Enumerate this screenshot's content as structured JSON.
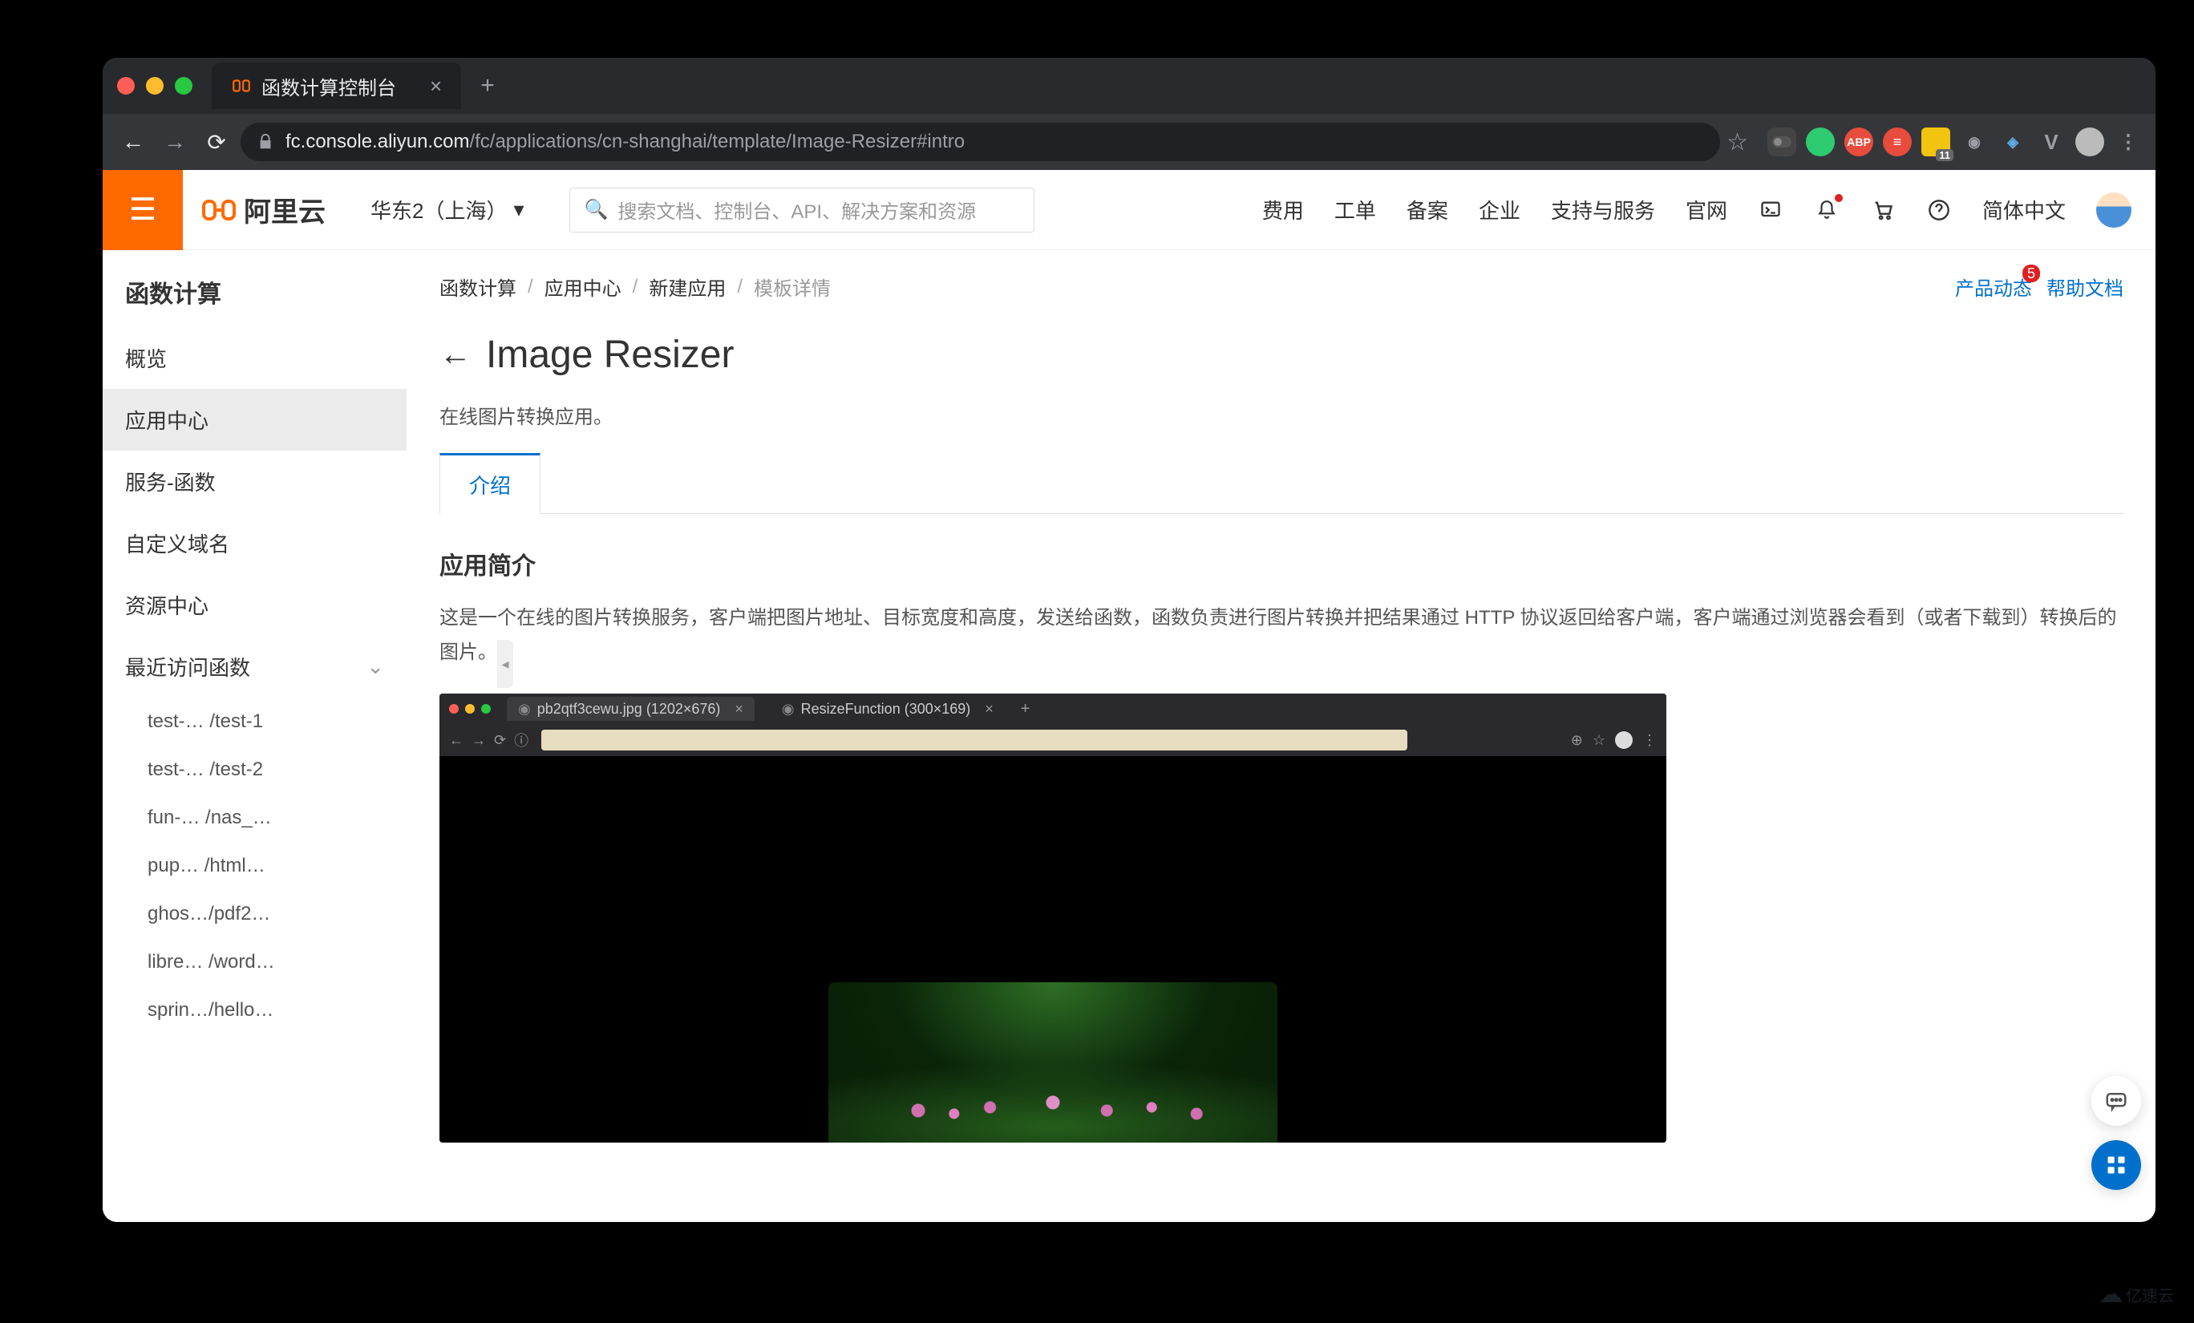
{
  "browser": {
    "tab_title": "函数计算控制台",
    "url_prefix": "fc.console.aliyun.com",
    "url_path": "/fc/applications/cn-shanghai/template/Image-Resizer#intro",
    "ext_badges": {
      "abp": "ABP",
      "num": "11"
    }
  },
  "header": {
    "logo_text": "阿里云",
    "region": "华东2（上海）",
    "search_placeholder": "搜索文档、控制台、API、解决方案和资源",
    "nav": [
      "费用",
      "工单",
      "备案",
      "企业",
      "支持与服务",
      "官网"
    ],
    "lang": "简体中文"
  },
  "sidebar": {
    "title": "函数计算",
    "items": [
      "概览",
      "应用中心",
      "服务-函数",
      "自定义域名",
      "资源中心"
    ],
    "recent_label": "最近访问函数",
    "recent": [
      "test-… /test-1",
      "test-… /test-2",
      "fun-… /nas_…",
      "pup… /html…",
      "ghos…/pdf2…",
      "libre… /word…",
      "sprin…/hello…"
    ]
  },
  "breadcrumb": {
    "items": [
      "函数计算",
      "应用中心",
      "新建应用"
    ],
    "current": "模板详情",
    "notice": "产品动态",
    "notice_badge": "5",
    "help": "帮助文档"
  },
  "page": {
    "title": "Image Resizer",
    "desc": "在线图片转换应用。",
    "tab": "介绍",
    "section_title": "应用简介",
    "section_desc": "这是一个在线的图片转换服务，客户端把图片地址、目标宽度和高度，发送给函数，函数负责进行图片转换并把结果通过 HTTP 协议返回给客户端，客户端通过浏览器会看到（或者下载到）转换后的图片。"
  },
  "demo": {
    "tab1": "pb2qtf3cewu.jpg (1202×676)",
    "tab2": "ResizeFunction (300×169)"
  },
  "watermark": "亿速云"
}
